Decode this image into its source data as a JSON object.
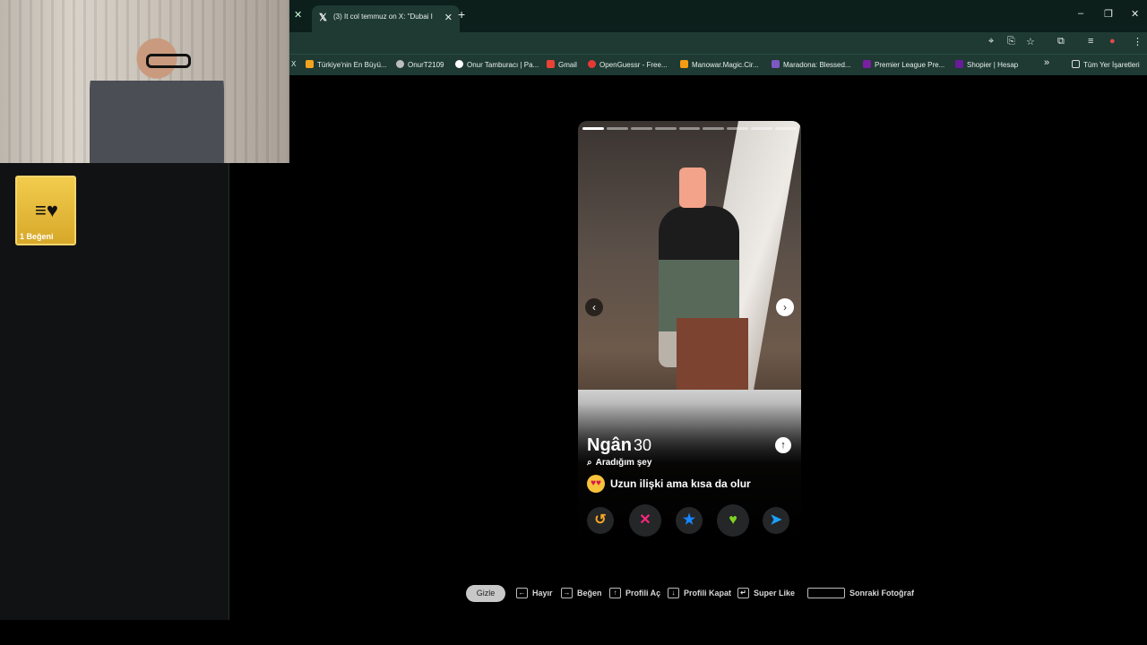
{
  "browser": {
    "tab": {
      "title": "(3) It col temmuz on X: \"Dubai I",
      "close": "✕"
    },
    "new_tab": "+",
    "window_controls": [
      "–",
      "❐",
      "✕"
    ]
  },
  "bookmarks": {
    "items": [
      {
        "label": "Türkiye'nin En Büyü...",
        "color": "#f2a31d"
      },
      {
        "label": "OnurT2109",
        "color": "#bdbdbd"
      },
      {
        "label": "Onur Tamburacı | Pa...",
        "color": "#ffffff"
      },
      {
        "label": "Gmail",
        "color": "#ea4335"
      },
      {
        "label": "OpenGuessr - Free...",
        "color": "#e53935"
      },
      {
        "label": "Manowar.Magic.Cir...",
        "color": "#f39c12"
      },
      {
        "label": "Maradona: Blessed...",
        "color": "#7e57c2"
      },
      {
        "label": "Premier League Pre...",
        "color": "#7b1fa2"
      },
      {
        "label": "Shopier | Hesap",
        "color": "#6a1b9a"
      }
    ],
    "more": "»",
    "all_bookmarks": "Tüm Yer İşaretleri"
  },
  "sidebar": {
    "likes_card_label": "1 Beğeni"
  },
  "profile": {
    "name": "Ngân",
    "age": "30",
    "looking_for_label": "Aradığım şey",
    "looking_for_value": "Uzun ilişki ama kısa da olur",
    "photo_count": 9,
    "current_photo": 1
  },
  "actions": {
    "rewind": "↺",
    "nope": "✕",
    "super_like": "★",
    "like": "♥",
    "boost": "➤"
  },
  "hints": {
    "hide": "Gizle",
    "no": "Hayır",
    "like": "Beğen",
    "open_profile": "Profili Aç",
    "close_profile": "Profili Kapat",
    "super_like": "Super Like",
    "next_photo": "Sonraki Fotoğraf"
  },
  "colors": {
    "accent_gold": "#f2cc4d",
    "nope_pink": "#fd267d",
    "super_blue": "#1786ff",
    "like_green": "#7fd322",
    "rewind_orange": "#f5a623",
    "boost_blue": "#1aa0ff"
  }
}
